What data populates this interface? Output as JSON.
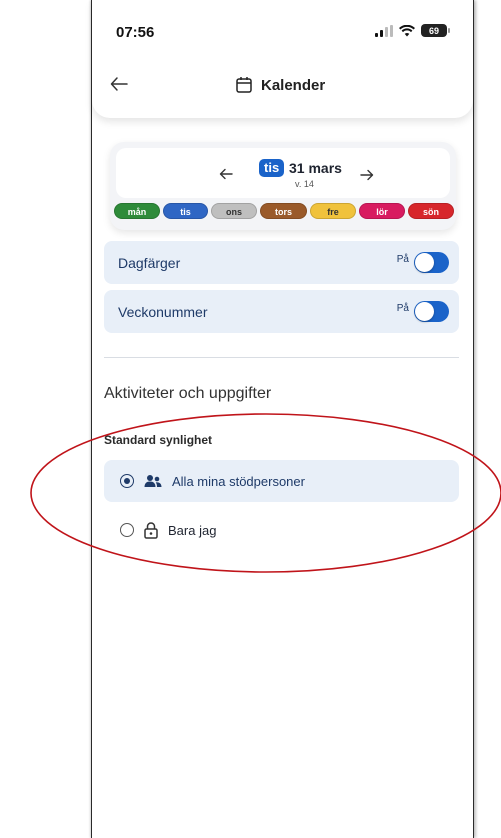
{
  "status_bar": {
    "time": "07:56",
    "battery": "69"
  },
  "header": {
    "title": "Kalender"
  },
  "calendar": {
    "day_badge": "tis",
    "date": "31 mars",
    "week": "v. 14",
    "days": [
      {
        "label": "mån",
        "color": "#2e8b3a"
      },
      {
        "label": "tis",
        "color": "#2f66c4"
      },
      {
        "label": "ons",
        "color": "#bfbfbf"
      },
      {
        "label": "tors",
        "color": "#9a5a2a"
      },
      {
        "label": "fre",
        "color": "#f0c23c"
      },
      {
        "label": "lör",
        "color": "#d81b60"
      },
      {
        "label": "sön",
        "color": "#d7262b"
      }
    ]
  },
  "settings": {
    "day_colors": {
      "label": "Dagfärger",
      "state": "På"
    },
    "week_numbers": {
      "label": "Veckonummer",
      "state": "På"
    }
  },
  "activities": {
    "section_title": "Aktiviteter och uppgifter",
    "visibility_title": "Standard synlighet",
    "options": [
      {
        "label": "Alla mina stödpersoner",
        "icon": "people-icon",
        "selected": true
      },
      {
        "label": "Bara jag",
        "icon": "lock-icon",
        "selected": false
      }
    ]
  },
  "colors": {
    "accent": "#1a63c9",
    "row_bg": "#e8eff8",
    "annotation": "#c0141a"
  }
}
